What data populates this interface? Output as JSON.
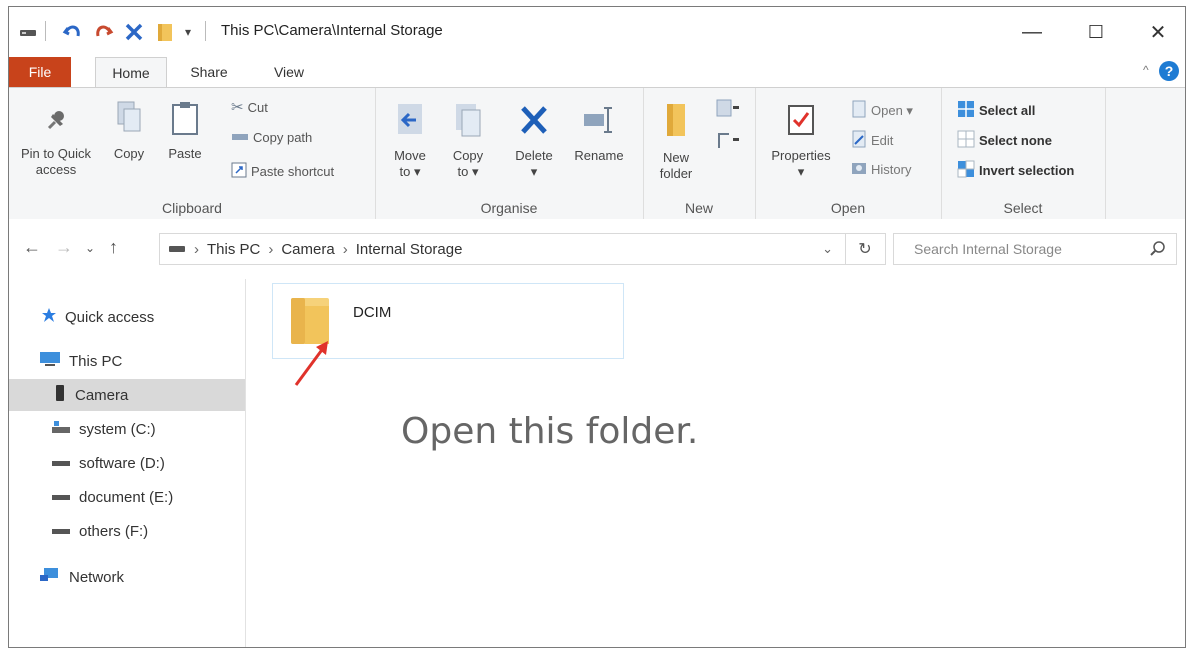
{
  "titlebar": {
    "path": "This PC\\Camera\\Internal Storage",
    "minimize": "—",
    "maximize": "☐",
    "close": "✕"
  },
  "tabs": [
    {
      "label": "File"
    },
    {
      "label": "Home"
    },
    {
      "label": "Share"
    },
    {
      "label": "View"
    }
  ],
  "ribbon": {
    "clipboard": {
      "label": "Clipboard",
      "pin_line1": "Pin to Quick",
      "pin_line2": "access",
      "copy": "Copy",
      "paste": "Paste",
      "cut": "Cut",
      "copy_path": "Copy path",
      "paste_shortcut": "Paste shortcut"
    },
    "organise": {
      "label": "Organise",
      "move_to_line1": "Move",
      "move_to_line2": "to ▾",
      "copy_to_line1": "Copy",
      "copy_to_line2": "to ▾",
      "delete_line1": "Delete",
      "delete_line2": "▾",
      "rename": "Rename"
    },
    "new": {
      "label": "New",
      "new_folder_line1": "New",
      "new_folder_line2": "folder"
    },
    "open": {
      "label": "Open",
      "properties_line1": "Properties",
      "properties_line2": "▾",
      "open": "Open ▾",
      "edit": "Edit",
      "history": "History"
    },
    "select": {
      "label": "Select",
      "select_all": "Select all",
      "select_none": "Select none",
      "invert_selection": "Invert selection"
    }
  },
  "address": {
    "this_pc": "This PC",
    "camera": "Camera",
    "internal_storage": "Internal Storage",
    "search_placeholder": "Search Internal Storage"
  },
  "nav": {
    "quick_access": "Quick access",
    "this_pc": "This PC",
    "camera": "Camera",
    "system": "system (C:)",
    "software": "software (D:)",
    "document": "document (E:)",
    "others": "others (F:)",
    "network": "Network"
  },
  "content": {
    "folder_name": "DCIM",
    "instruction": "Open this folder."
  },
  "colors": {
    "file_tab": "#c8431b",
    "folder": "#f2c45b",
    "accent_blue": "#1e7bd3",
    "arrow_red": "#e0322b",
    "selected_nav": "#d9d9d9"
  }
}
